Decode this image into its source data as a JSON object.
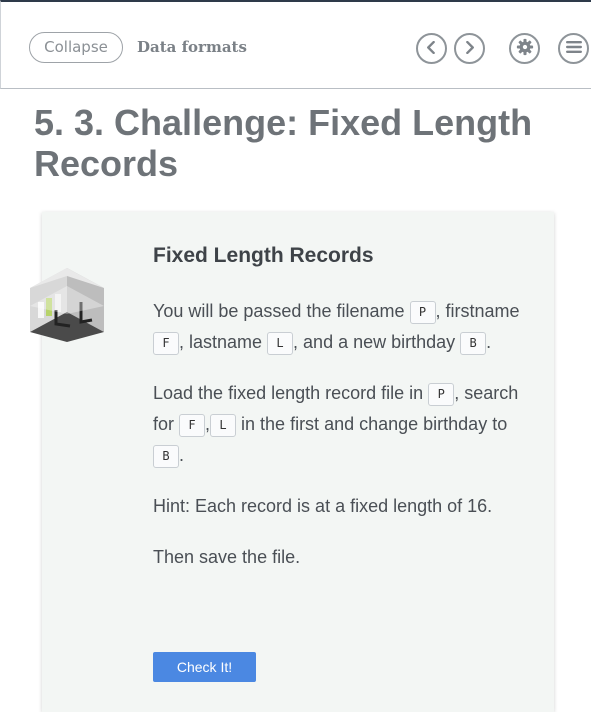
{
  "header": {
    "collapse_label": "Collapse",
    "breadcrumb": "Data formats",
    "icons": [
      "chevron-left-icon",
      "chevron-right-icon",
      "gear-icon",
      "menu-icon"
    ]
  },
  "page": {
    "title": "5. 3. Challenge: Fixed Length Records"
  },
  "card": {
    "title": "Fixed Length Records",
    "p1": {
      "t1": "You will be passed the filename ",
      "c1": "P",
      "t2": ", firstname ",
      "c2": "F",
      "t3": ", lastname ",
      "c3": "L",
      "t4": ", and a new birthday ",
      "c4": "B",
      "t5": "."
    },
    "p2": {
      "t1": "Load the fixed length record file in ",
      "c1": "P",
      "t2": ", search for ",
      "c2": "F",
      "t3": ",",
      "c3": "L",
      "t4": " in the first and change birthday to ",
      "c4": "B",
      "t5": "."
    },
    "p3": "Hint: Each record is at a fixed length of 16.",
    "p4": "Then save the file.",
    "check_label": "Check It!"
  },
  "colors": {
    "accent": "#4b88e2",
    "card_background": "#f3f6f4",
    "title_text": "#6e7378"
  }
}
